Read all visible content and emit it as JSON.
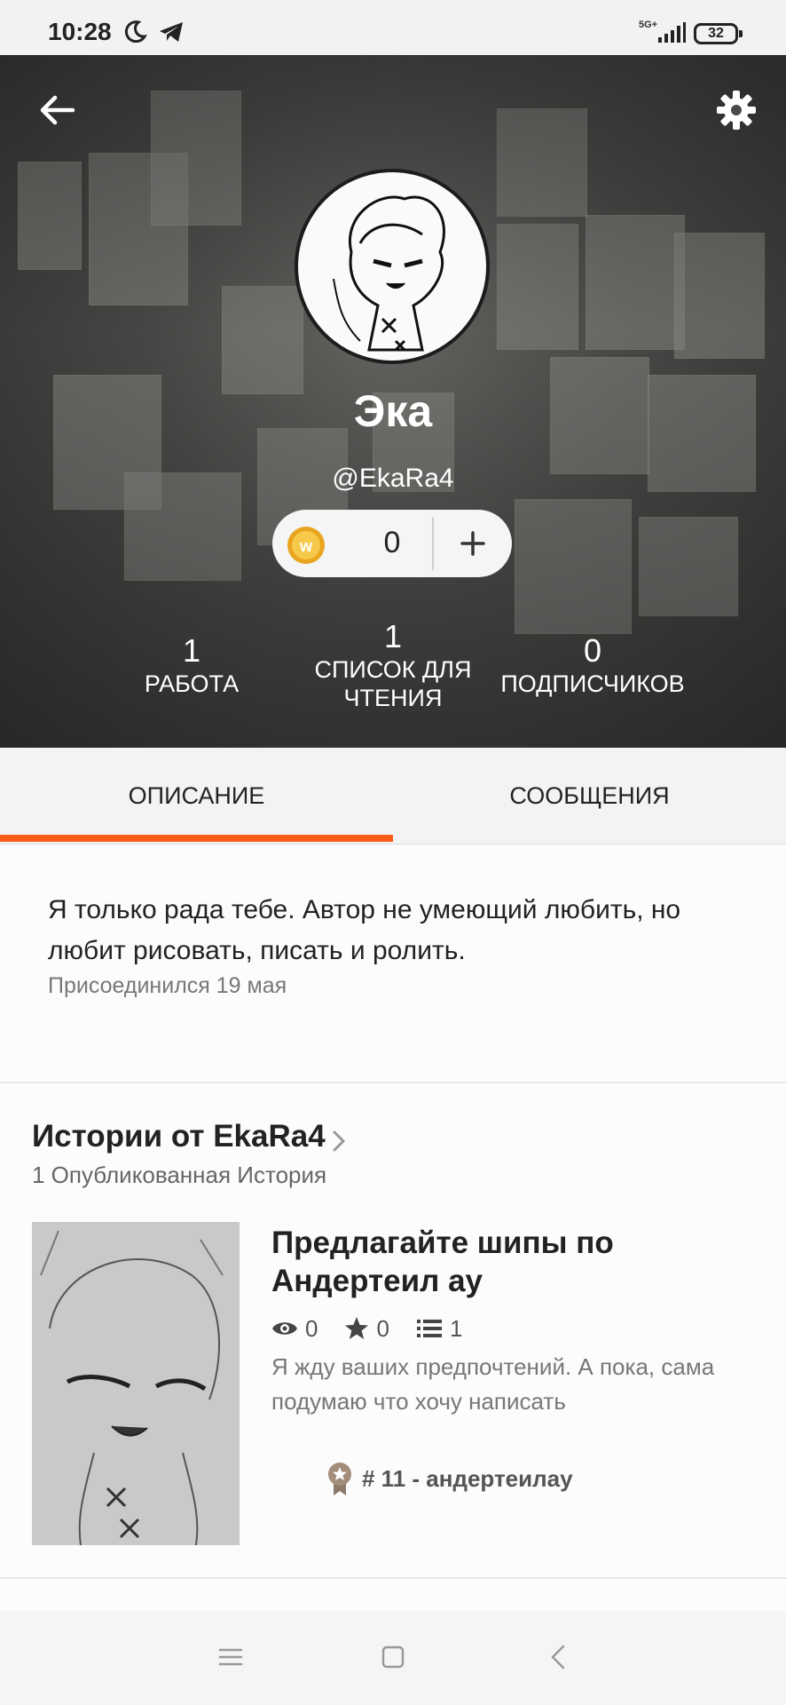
{
  "status_bar": {
    "time": "10:28",
    "network": "5G+",
    "battery": "32",
    "icons": [
      "moon-icon",
      "telegram-icon",
      "signal-icon",
      "battery-icon"
    ]
  },
  "header": {
    "back_icon": "arrow-left-icon",
    "settings_icon": "gear-icon"
  },
  "profile": {
    "display_name": "Эка",
    "username": "@EkaRa4",
    "coins": "0",
    "coin_icon": "wattpad-coin-icon",
    "add_icon": "plus-icon"
  },
  "stats": [
    {
      "value": "1",
      "label": "РАБОТА"
    },
    {
      "value": "1",
      "label": "СПИСОК ДЛЯ ЧТЕНИЯ"
    },
    {
      "value": "0",
      "label": "ПОДПИСЧИКОВ"
    }
  ],
  "tabs": [
    {
      "label": "ОПИСАНИЕ",
      "active": true
    },
    {
      "label": "СООБЩЕНИЯ",
      "active": false
    }
  ],
  "about": {
    "text": "Я только рада тебе. Автор не умеющий любить, но любит рисовать, писать и ролить.",
    "joined": "Присоединился 19 мая"
  },
  "stories": {
    "header": "Истории от EkaRa4",
    "count_label": "1 Опубликованная История",
    "items": [
      {
        "title": "Предлагайте шипы по Андертеил ау",
        "reads": "0",
        "votes": "0",
        "parts": "1",
        "description": "Я жду ваших предпочтений. А пока, сама подумаю что хочу написать",
        "rank": "# 11 - андертеилау"
      }
    ]
  },
  "colors": {
    "accent": "#ff5c1a",
    "tab_bg": "#f4f3f4",
    "coin": "#f2b632"
  },
  "navbar": {
    "icons": [
      "menu-icon",
      "home-square-icon",
      "back-triangle-icon"
    ]
  }
}
